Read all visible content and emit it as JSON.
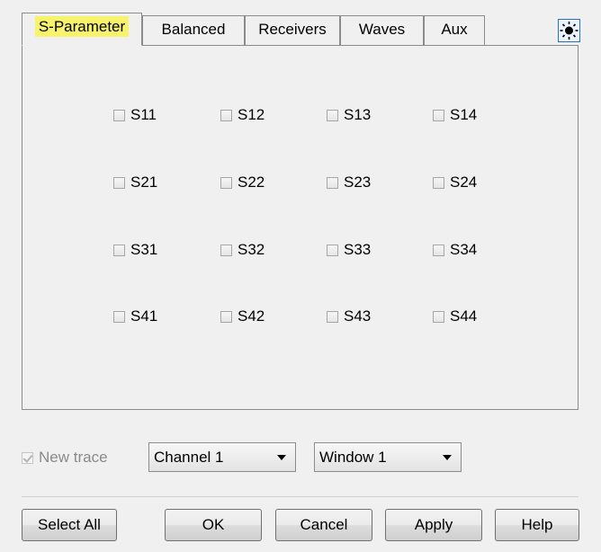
{
  "tabs": [
    {
      "label": "S-Parameter",
      "active": true
    },
    {
      "label": "Balanced",
      "active": false
    },
    {
      "label": "Receivers",
      "active": false
    },
    {
      "label": "Waves",
      "active": false
    },
    {
      "label": "Aux",
      "active": false
    }
  ],
  "params": {
    "s11": "S11",
    "s12": "S12",
    "s13": "S13",
    "s14": "S14",
    "s21": "S21",
    "s22": "S22",
    "s23": "S23",
    "s24": "S24",
    "s31": "S31",
    "s32": "S32",
    "s33": "S33",
    "s34": "S34",
    "s41": "S41",
    "s42": "S42",
    "s43": "S43",
    "s44": "S44"
  },
  "new_trace": {
    "label": "New trace",
    "checked": true,
    "enabled": false
  },
  "channel_select": {
    "value": "Channel 1"
  },
  "window_select": {
    "value": "Window 1"
  },
  "buttons": {
    "select_all": "Select All",
    "ok": "OK",
    "cancel": "Cancel",
    "apply": "Apply",
    "help": "Help"
  },
  "icons": {
    "light_toggle": "sun-icon"
  },
  "colors": {
    "tab_highlight": "#f7f36a",
    "light_button_border": "#2a6fc9"
  }
}
